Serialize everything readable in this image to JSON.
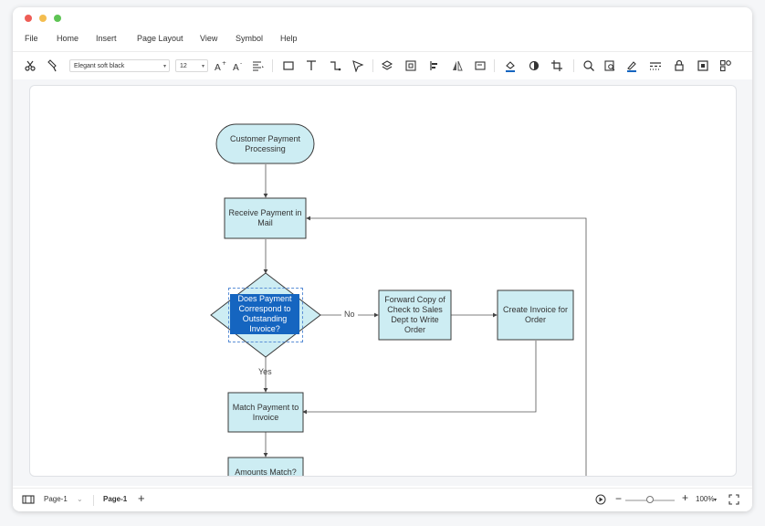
{
  "window": {
    "controls": [
      {
        "name": "close",
        "color": "#ee5d56"
      },
      {
        "name": "minimize",
        "color": "#f4bd4f"
      },
      {
        "name": "maximize",
        "color": "#5ec454"
      }
    ]
  },
  "menu": [
    "File",
    "Home",
    "Insert",
    "Page Layout",
    "View",
    "Symbol",
    "Help"
  ],
  "toolbar": {
    "font_family": "Elegant soft black",
    "font_size": "12"
  },
  "diagram": {
    "nodes": {
      "start": "Customer Payment Processing",
      "receive": "Receive Payment in Mail",
      "decision": "Does Payment Correspond to Outstanding Invoice?",
      "forward": "Forward Copy of Check to Sales Dept to Write Order",
      "create_invoice": "Create Invoice for Order",
      "match": "Match Payment to Invoice",
      "amounts": "Amounts Match?"
    },
    "edge_labels": {
      "no": "No",
      "yes": "Yes"
    },
    "colors": {
      "fill": "#cdedf3",
      "stroke": "#3a3a3a",
      "line": "#555555",
      "selection": "#1565c0"
    }
  },
  "status": {
    "page_dropdown": "Page-1",
    "page_tab": "Page-1",
    "zoom_percent": 100,
    "zoom_label": "100%"
  }
}
